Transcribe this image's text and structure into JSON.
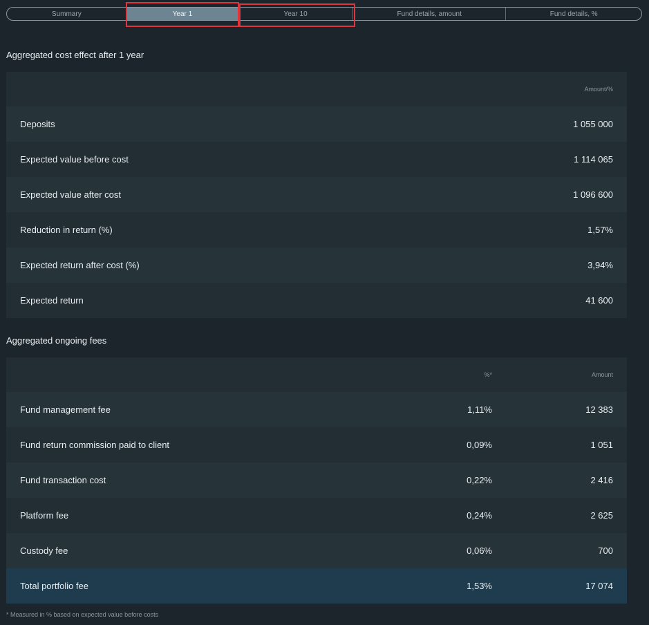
{
  "tabs": [
    {
      "label": "Summary"
    },
    {
      "label": "Year 1"
    },
    {
      "label": "Year 10"
    },
    {
      "label": "Fund details, amount"
    },
    {
      "label": "Fund details, %"
    }
  ],
  "cost_effect": {
    "title": "Aggregated cost effect after 1 year",
    "col_header": "Amount/%",
    "rows": [
      {
        "label": "Deposits",
        "value": "1 055 000"
      },
      {
        "label": "Expected value before cost",
        "value": "1 114 065"
      },
      {
        "label": "Expected value after cost",
        "value": "1 096 600"
      },
      {
        "label": "Reduction in return (%)",
        "value": "1,57%"
      },
      {
        "label": "Expected return after cost (%)",
        "value": "3,94%"
      },
      {
        "label": "Expected return",
        "value": "41 600"
      }
    ]
  },
  "ongoing_fees": {
    "title": "Aggregated ongoing fees",
    "col_pct": "%*",
    "col_amount": "Amount",
    "rows": [
      {
        "label": "Fund management fee",
        "pct": "1,11%",
        "amount": "12 383"
      },
      {
        "label": "Fund return commission paid to client",
        "pct": "0,09%",
        "amount": "1 051"
      },
      {
        "label": "Fund transaction cost",
        "pct": "0,22%",
        "amount": "2 416"
      },
      {
        "label": "Platform fee",
        "pct": "0,24%",
        "amount": "2 625"
      },
      {
        "label": "Custody fee",
        "pct": "0,06%",
        "amount": "700"
      }
    ],
    "total": {
      "label": "Total portfolio fee",
      "pct": "1,53%",
      "amount": "17 074"
    }
  },
  "footnote": "* Measured in % based on expected value before costs",
  "colors": {
    "background": "#1c252b",
    "active_tab": "#6d8593",
    "total_row": "#1f3c4e",
    "highlight": "#e1343c"
  }
}
